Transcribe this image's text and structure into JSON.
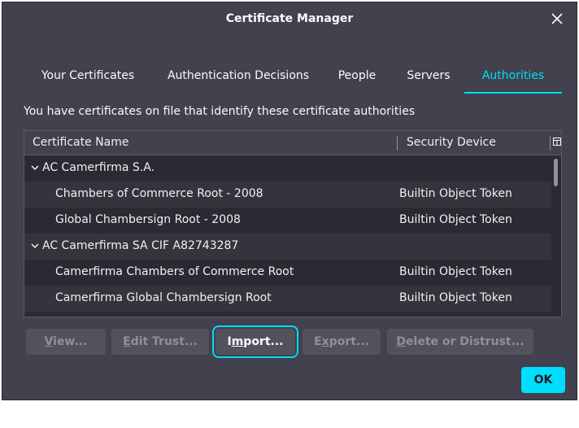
{
  "dialog": {
    "title": "Certificate Manager"
  },
  "tabs": [
    {
      "label": "Your Certificates"
    },
    {
      "label": "Authentication Decisions"
    },
    {
      "label": "People"
    },
    {
      "label": "Servers"
    },
    {
      "label": "Authorities",
      "active": true
    }
  ],
  "description": "You have certificates on file that identify these certificate authorities",
  "tree": {
    "columns": {
      "name": "Certificate Name",
      "device": "Security Device"
    },
    "rows": [
      {
        "type": "group",
        "label": "AC Camerfirma S.A.",
        "expanded": true
      },
      {
        "type": "item",
        "name": "Chambers of Commerce Root - 2008",
        "device": "Builtin Object Token"
      },
      {
        "type": "item",
        "name": "Global Chambersign Root - 2008",
        "device": "Builtin Object Token"
      },
      {
        "type": "group",
        "label": "AC Camerfirma SA CIF A82743287",
        "expanded": true
      },
      {
        "type": "item",
        "name": "Camerfirma Chambers of Commerce Root",
        "device": "Builtin Object Token"
      },
      {
        "type": "item",
        "name": "Camerfirma Global Chambersign Root",
        "device": "Builtin Object Token"
      }
    ]
  },
  "buttons": {
    "view": {
      "mnemonic": "V",
      "rest": "iew..."
    },
    "edit_trust": {
      "mnemonic": "E",
      "rest": "dit Trust..."
    },
    "import": {
      "pre": "I",
      "mnemonic": "m",
      "rest": "port..."
    },
    "export": {
      "pre": "E",
      "mnemonic": "x",
      "rest": "port..."
    },
    "delete": {
      "mnemonic": "D",
      "rest": "elete or Distrust..."
    },
    "ok": "OK"
  },
  "colors": {
    "accent": "#00ddff",
    "dialog_bg": "#42414d",
    "tree_bg": "#2b2a33"
  },
  "icons": {
    "close": "close-icon",
    "expand": "chevron-down-icon",
    "column_picker": "column-picker-icon"
  }
}
